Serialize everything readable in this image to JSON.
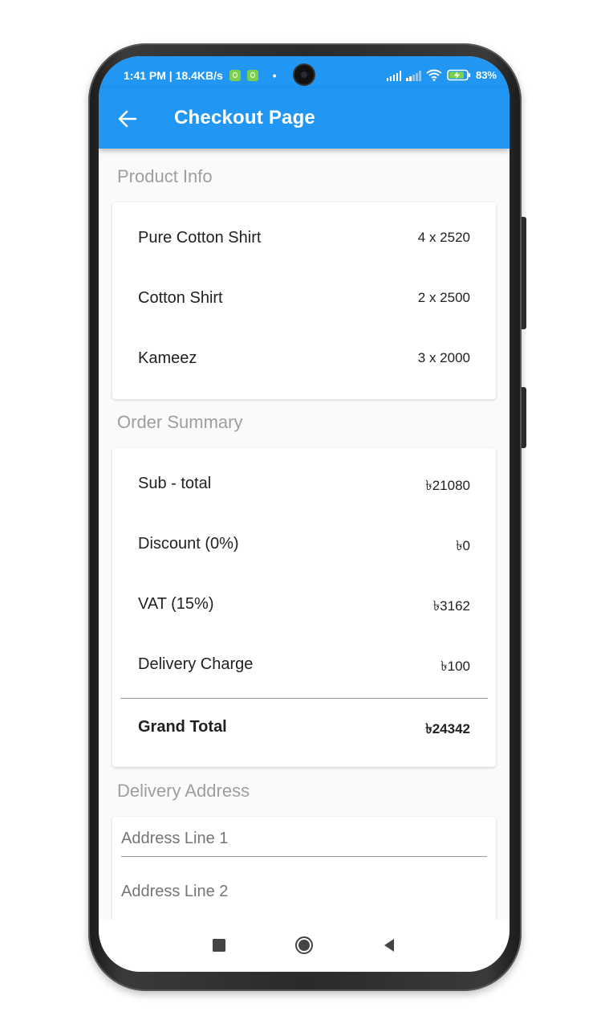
{
  "status_bar": {
    "time_speed": "1:41 PM | 18.4KB/s",
    "dot": "•",
    "battery_percent": "83%"
  },
  "app_bar": {
    "title": "Checkout Page",
    "back_icon": "arrow-left-icon"
  },
  "product_info": {
    "section_title": "Product Info",
    "items": [
      {
        "name": "Pure Cotton Shirt",
        "qty_price": "4 x 2520"
      },
      {
        "name": "Cotton Shirt",
        "qty_price": "2 x 2500"
      },
      {
        "name": "Kameez",
        "qty_price": "3 x 2000"
      }
    ]
  },
  "order_summary": {
    "section_title": "Order Summary",
    "rows": [
      {
        "label": "Sub - total",
        "value": "৳21080"
      },
      {
        "label": "Discount (0%)",
        "value": "৳0"
      },
      {
        "label": "VAT (15%)",
        "value": "৳3162"
      },
      {
        "label": "Delivery Charge",
        "value": "৳100"
      }
    ],
    "grand_total": {
      "label": "Grand Total",
      "value": "৳24342"
    }
  },
  "delivery_address": {
    "section_title": "Delivery Address",
    "fields": [
      {
        "placeholder": "Address Line 1"
      },
      {
        "placeholder": "Address Line 2"
      }
    ]
  },
  "colors": {
    "primary": "#2196f3",
    "background": "#fafafa",
    "section_title": "#9e9e9e"
  },
  "nav_bar": {
    "icons": [
      "recent-apps-icon",
      "home-icon",
      "back-triangle-icon"
    ]
  }
}
